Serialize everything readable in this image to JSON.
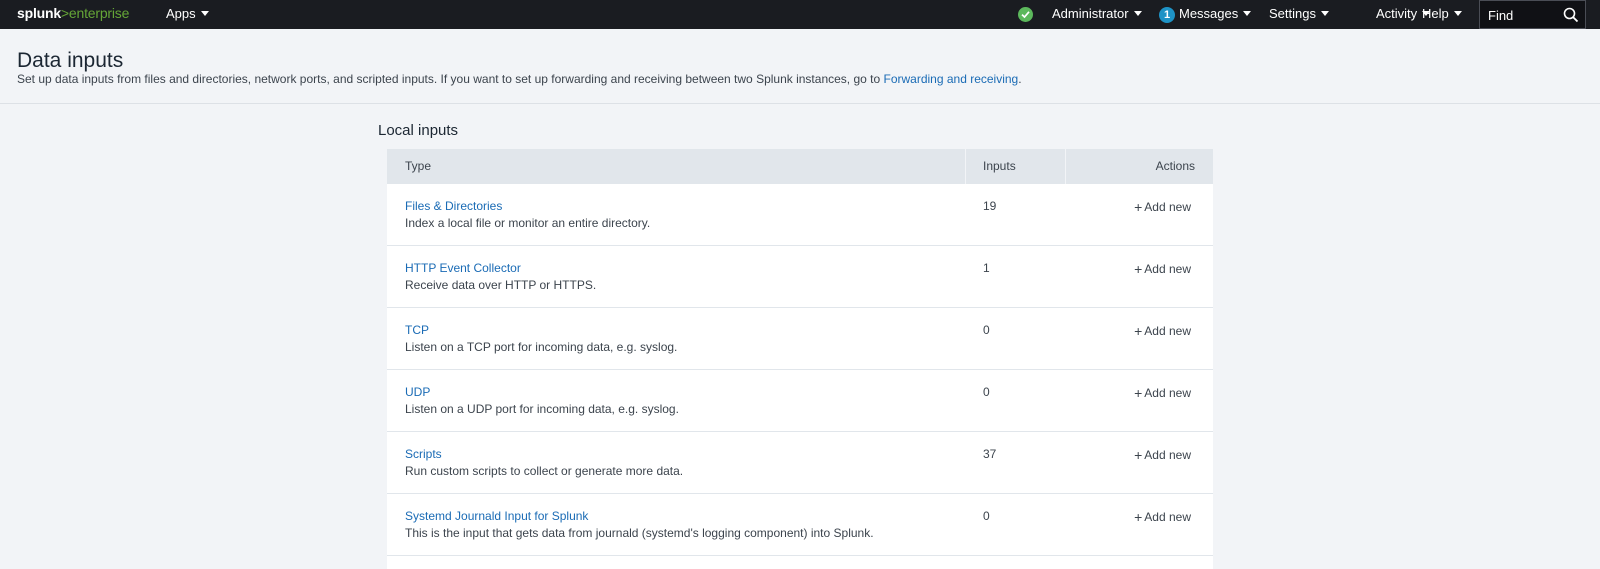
{
  "topbar": {
    "logo_splunk": "splunk",
    "logo_arrow": ">",
    "logo_enterprise": "enterprise",
    "apps_label": "Apps",
    "status_color": "#5cb85c",
    "user_label": "Administrator",
    "messages_count": "1",
    "messages_label": "Messages",
    "settings_label": "Settings",
    "activity_label": "Activity",
    "help_label": "Help",
    "find_placeholder": "Find"
  },
  "header": {
    "title": "Data inputs",
    "description": "Set up data inputs from files and directories, network ports, and scripted inputs. If you want to set up forwarding and receiving between two Splunk instances, go to ",
    "link_text": "Forwarding and receiving",
    "trailing": "."
  },
  "local_inputs": {
    "title": "Local inputs",
    "columns": {
      "type": "Type",
      "inputs": "Inputs",
      "actions": "Actions"
    },
    "rows": [
      {
        "name": "Files & Directories",
        "description": "Index a local file or monitor an entire directory.",
        "count": "19",
        "action": "Add new"
      },
      {
        "name": "HTTP Event Collector",
        "description": "Receive data over HTTP or HTTPS.",
        "count": "1",
        "action": "Add new"
      },
      {
        "name": "TCP",
        "description": "Listen on a TCP port for incoming data, e.g. syslog.",
        "count": "0",
        "action": "Add new"
      },
      {
        "name": "UDP",
        "description": "Listen on a UDP port for incoming data, e.g. syslog.",
        "count": "0",
        "action": "Add new"
      },
      {
        "name": "Scripts",
        "description": "Run custom scripts to collect or generate more data.",
        "count": "37",
        "action": "Add new"
      },
      {
        "name": "Systemd Journald Input for Splunk",
        "description": "This is the input that gets data from journald (systemd's logging component) into Splunk.",
        "count": "0",
        "action": "Add new"
      }
    ]
  }
}
